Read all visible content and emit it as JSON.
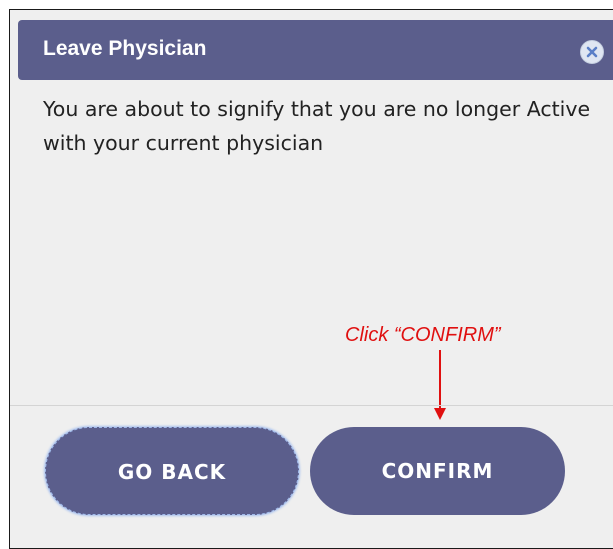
{
  "dialog": {
    "title": "Leave Physician",
    "message": "You are about to signify that you are no longer Active with your current physician",
    "go_back_label": "GO BACK",
    "confirm_label": "CONFIRM"
  },
  "annotation": {
    "text": "Click “CONFIRM”",
    "color": "#e01010"
  },
  "icons": {
    "close": "close-icon",
    "arrow": "arrow-down-icon"
  },
  "colors": {
    "title_bar": "#5b5e8c",
    "button": "#5b5e8c",
    "body": "#efefef"
  }
}
